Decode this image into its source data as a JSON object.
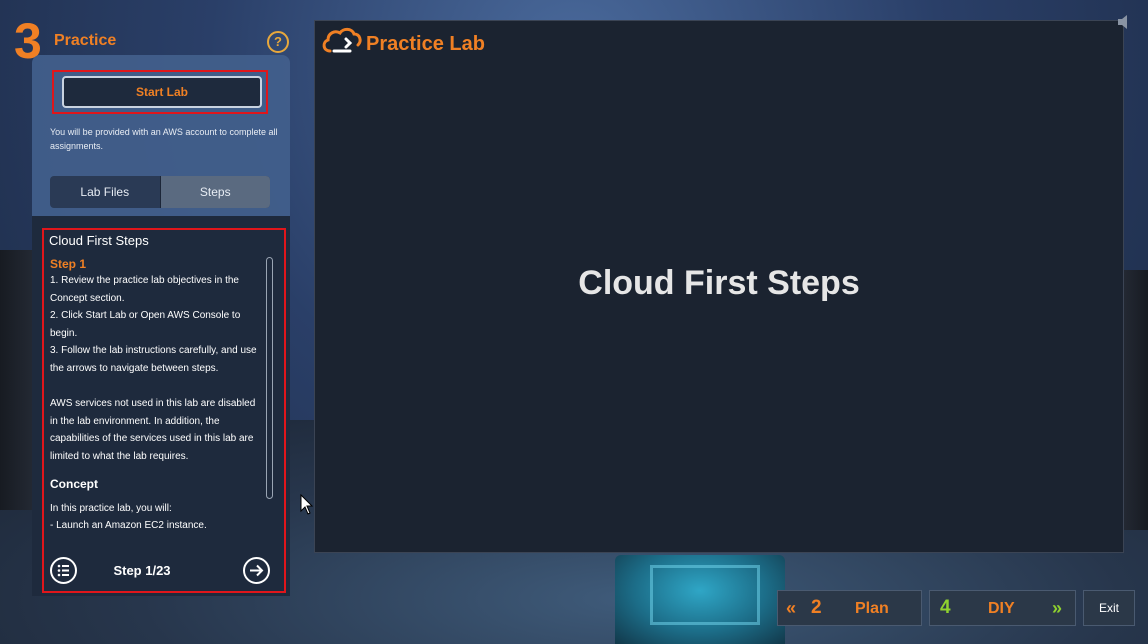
{
  "header": {
    "section_number": "3",
    "section_title": "Practice",
    "help_glyph": "?"
  },
  "lab": {
    "start_button": "Start Lab",
    "account_note": "You will be provided with an AWS account to complete all assignments."
  },
  "tabs": [
    {
      "label": "Lab Files",
      "selected": false
    },
    {
      "label": "Steps",
      "selected": true
    }
  ],
  "steps": {
    "title": "Cloud First Steps",
    "step_heading": "Step 1",
    "lines": [
      "1. Review the practice lab objectives in the Concept section.",
      "2. Click Start Lab or Open AWS Console to begin.",
      "3. Follow the lab instructions carefully, and use the arrows to navigate between steps."
    ],
    "note": "AWS services not used in this lab are disabled in the lab environment. In addition, the capabilities of the services used in this lab are limited to what the lab requires.",
    "concept_heading": "Concept",
    "concept_intro": "In this practice lab, you will:",
    "concept_item": "- Launch an Amazon EC2 instance.",
    "counter": "Step 1/23"
  },
  "main": {
    "brand_title": "Practice Lab",
    "heading": "Cloud First Steps"
  },
  "nav": {
    "plan": {
      "number": "2",
      "label": "Plan",
      "chevron": "«"
    },
    "diy": {
      "number": "4",
      "label": "DIY",
      "chevron": "»"
    },
    "exit": "Exit"
  },
  "icons": {
    "help": "help-icon",
    "menu": "list-menu-icon",
    "next": "arrow-right-circle-icon",
    "logo": "cloud-logo-icon",
    "speaker": "speaker-icon",
    "cursor": "mouse-cursor-icon"
  },
  "colors": {
    "accent_orange": "#f08024",
    "diy_green": "#8fd12f",
    "highlight_red": "#e0161b",
    "panel_dark": "#1b2330"
  }
}
